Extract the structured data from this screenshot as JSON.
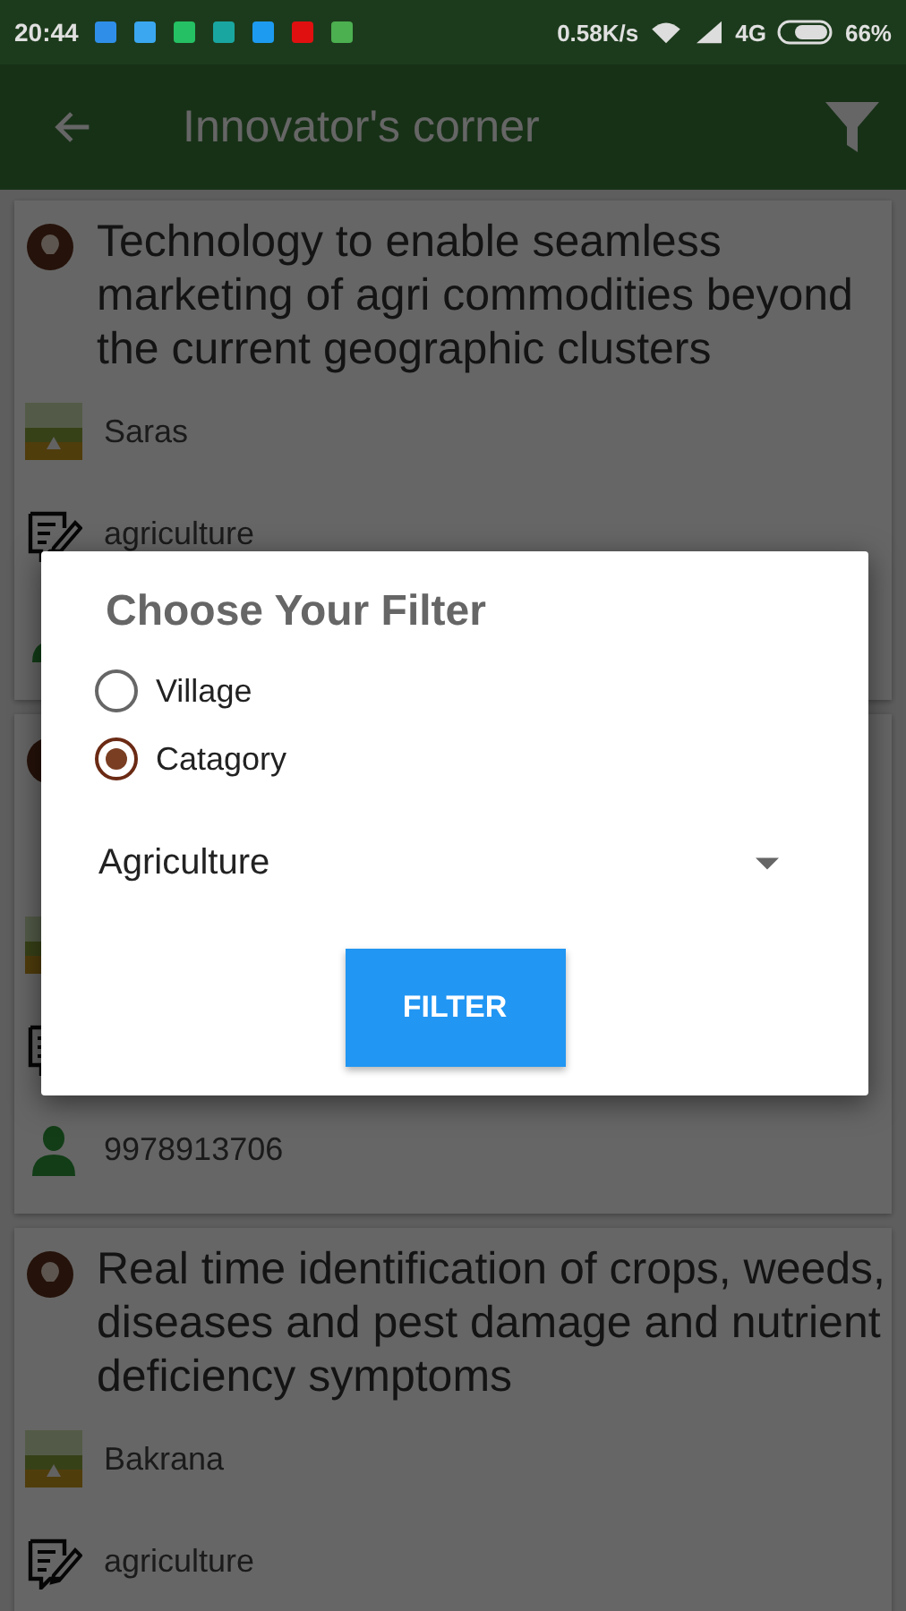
{
  "status_bar": {
    "time": "20:44",
    "speed": "0.58K/s",
    "network": "4G",
    "battery": "66%"
  },
  "app_bar": {
    "title": "Innovator's corner"
  },
  "cards": [
    {
      "title": "Technology to enable seamless marketing of agri commodities beyond the current geographic clusters",
      "village": "Saras",
      "category": "agriculture"
    },
    {
      "phone": "9978913706"
    },
    {
      "title": "Real time identification of crops, weeds, diseases and pest damage and nutrient deficiency symptoms",
      "village": "Bakrana",
      "category": "agriculture"
    }
  ],
  "dialog": {
    "title": "Choose Your Filter",
    "options": [
      {
        "label": "Village",
        "selected": false
      },
      {
        "label": "Catagory",
        "selected": true
      }
    ],
    "dropdown": {
      "value": "Agriculture"
    },
    "button": "FILTER"
  }
}
